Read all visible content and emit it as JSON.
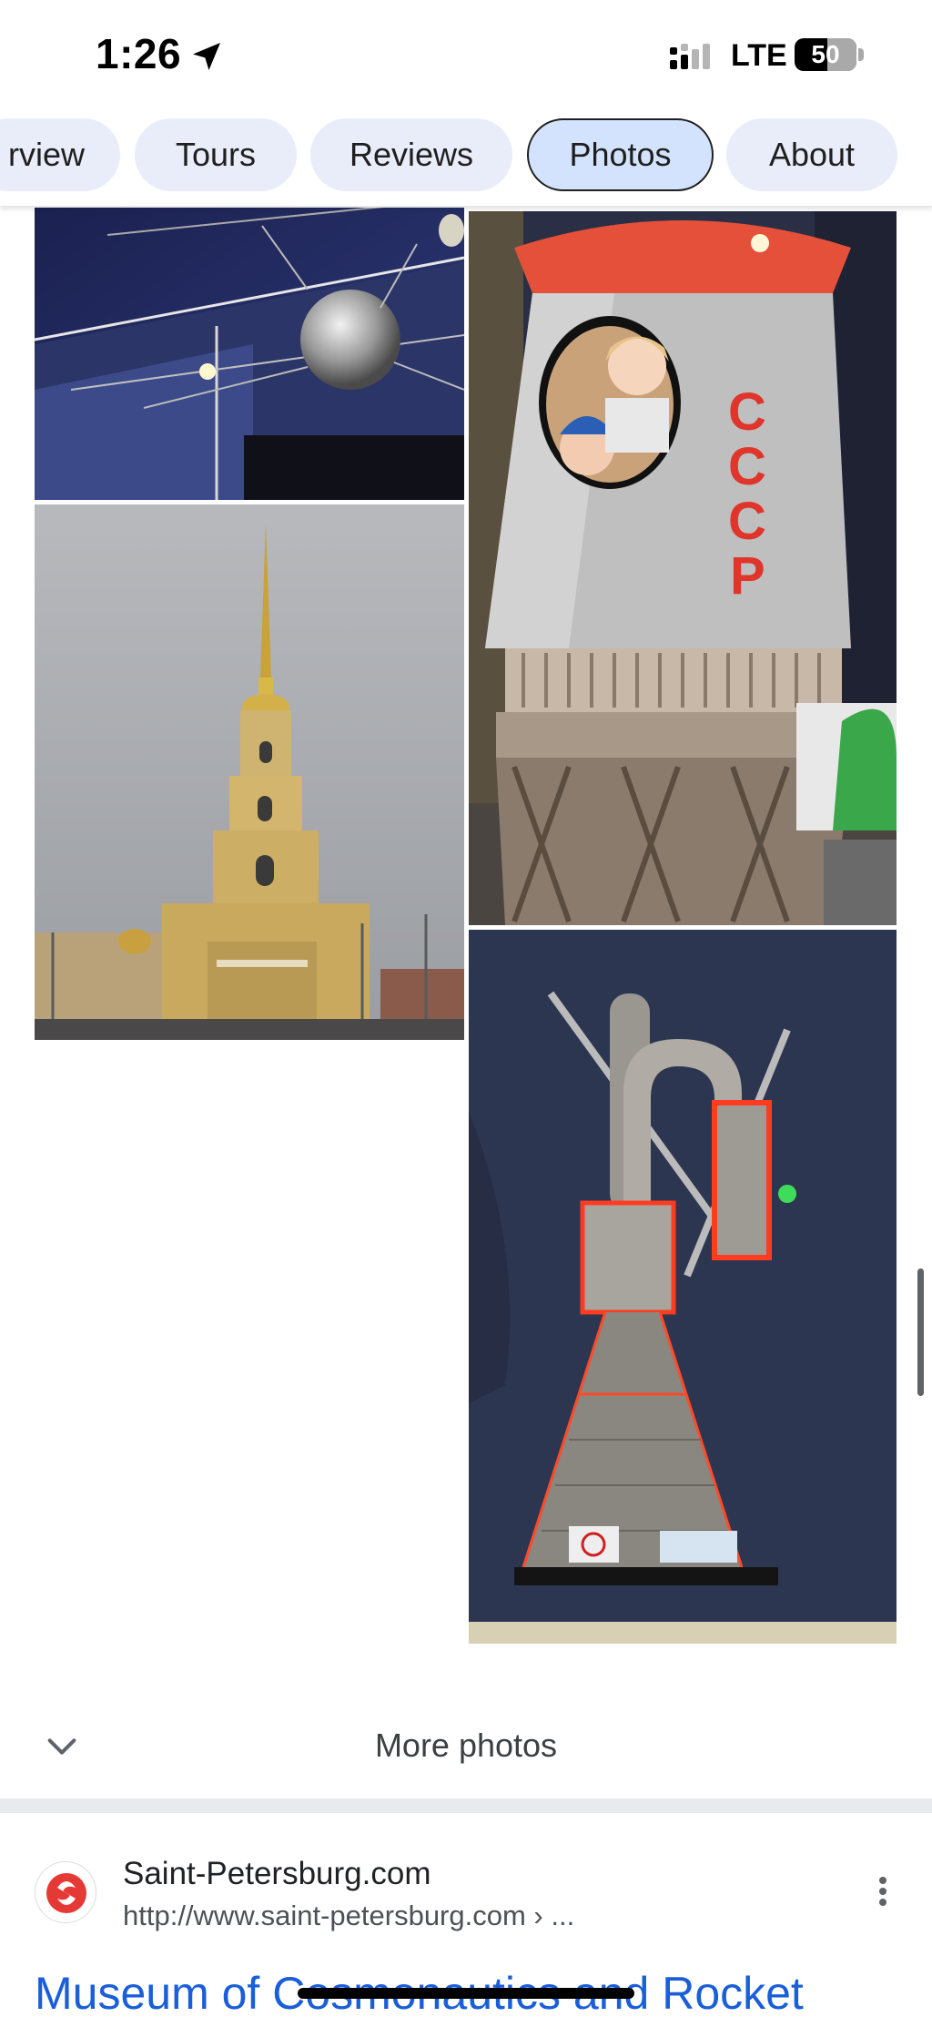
{
  "status_bar": {
    "time": "1:26",
    "network": "LTE",
    "battery": "50"
  },
  "tabs": [
    {
      "label": "rview",
      "active": false
    },
    {
      "label": "Tours",
      "active": false
    },
    {
      "label": "Reviews",
      "active": false
    },
    {
      "label": "Photos",
      "active": true
    },
    {
      "label": "About",
      "active": false
    }
  ],
  "photos": {
    "more_label": "More photos"
  },
  "result": {
    "site_name": "Saint-Petersburg.com",
    "url": "http://www.saint-petersburg.com",
    "url_path": " › ...",
    "title": "Museum of Cosmonautics and Rocket"
  },
  "colors": {
    "chip_bg": "#e8edf9",
    "chip_active_bg": "#d3e3fd",
    "link": "#1a5ed9"
  },
  "icons": [
    "location-arrow-icon",
    "signal-icon",
    "chevron-down-icon",
    "more-vert-icon",
    "site-favicon"
  ]
}
